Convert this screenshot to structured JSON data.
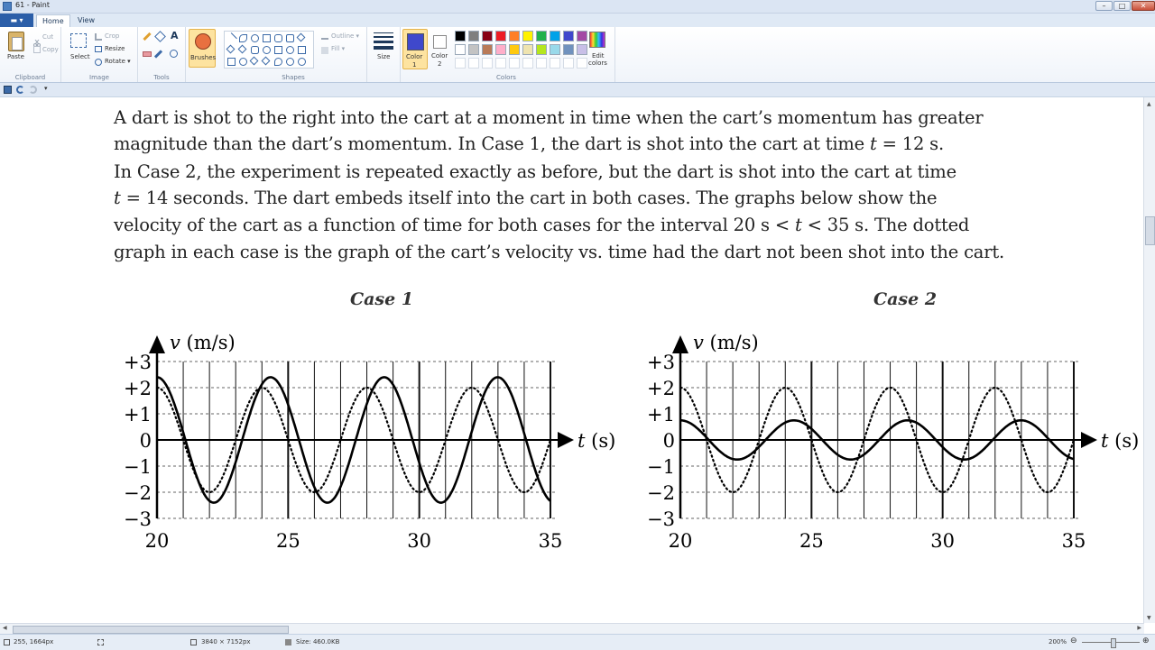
{
  "window": {
    "title": "61 - Paint",
    "minimize": "–",
    "maximize": "□",
    "close": "✕"
  },
  "tabs": {
    "file": "▬ ▾",
    "home": "Home",
    "view": "View"
  },
  "ribbon": {
    "clipboard": {
      "label": "Clipboard",
      "paste": "Paste",
      "cut": "Cut",
      "copy": "Copy"
    },
    "image": {
      "label": "Image",
      "select": "Select",
      "crop": "Crop",
      "resize": "Resize",
      "rotate": "Rotate ▾"
    },
    "tools": {
      "label": "Tools"
    },
    "brushes": {
      "label": "Brushes"
    },
    "shapes": {
      "label": "Shapes",
      "outline": "Outline ▾",
      "fill": "Fill ▾"
    },
    "size": {
      "label": "Size"
    },
    "color1": {
      "label1": "Color",
      "label2": "1",
      "value": "#3f48cc"
    },
    "color2": {
      "label1": "Color",
      "label2": "2",
      "value": "#ffffff"
    },
    "colors": {
      "label": "Colors",
      "edit1": "Edit",
      "edit2": "colors",
      "palette_row1": [
        "#000000",
        "#7f7f7f",
        "#880015",
        "#ed1c24",
        "#ff7f27",
        "#fff200",
        "#22b14c",
        "#00a2e8",
        "#3f48cc",
        "#a349a4"
      ],
      "palette_row2": [
        "#ffffff",
        "#c3c3c3",
        "#b97a57",
        "#ffaec9",
        "#ffc90e",
        "#efe4b0",
        "#b5e61d",
        "#99d9ea",
        "#7092be",
        "#c8bfe7"
      ]
    }
  },
  "document": {
    "lines": [
      "A dart is shot to the right into the cart at a moment in time when the cart’s momentum has greater",
      "magnitude than the dart’s momentum. In Case 1, the dart is shot into the cart at time 𝑡 = 12 s.",
      "In Case 2, the experiment is repeated exactly as before, but the dart is shot into the cart at time",
      "𝑡 = 14 seconds. The dart embeds itself into the cart in both cases. The graphs below show the",
      "velocity of the cart as a function of time for both cases for the interval 20 s < 𝑡 < 35 s. The dotted",
      "graph in each case is the graph of the cart’s velocity vs. time had the dart not been shot into the cart."
    ]
  },
  "chart_data": [
    {
      "type": "line",
      "title": "Case 1",
      "xlabel": "t (s)",
      "ylabel": "v (m/s)",
      "xlim": [
        20,
        35
      ],
      "ylim": [
        -3,
        3
      ],
      "xticks": [
        "20",
        "25",
        "30",
        "35"
      ],
      "yticks": [
        "+3",
        "+2",
        "+1",
        "0",
        "−1",
        "−2",
        "−3"
      ],
      "series": [
        {
          "style": "solid",
          "amplitude": 2.4,
          "period": 4.33,
          "x": [
            20,
            20.5,
            21,
            21.5,
            22,
            22.5,
            23,
            23.5,
            24,
            24.5,
            25,
            25.5,
            26,
            26.5,
            27,
            27.5,
            28,
            28.5,
            29,
            29.5,
            30,
            30.5,
            31,
            31.5,
            32,
            32.5,
            33,
            33.5,
            34,
            34.5,
            35
          ],
          "y": [
            2.4,
            1.7,
            0.2,
            -1.4,
            -2.4,
            -2.1,
            -0.8,
            1.0,
            2.2,
            2.3,
            1.1,
            -0.6,
            -2.0,
            -2.4,
            -1.6,
            0.0,
            1.6,
            2.4,
            2.0,
            0.6,
            -1.1,
            -2.2,
            -2.3,
            -1.1,
            0.6,
            2.0,
            2.4,
            1.6,
            0.0,
            -1.6,
            -2.4
          ]
        },
        {
          "style": "dotted",
          "amplitude": 2.0,
          "period": 4.0,
          "x": [
            20,
            21,
            22,
            23,
            24,
            25,
            26,
            27,
            28,
            29,
            30,
            31,
            32,
            33,
            34,
            35
          ],
          "y": [
            2,
            0,
            -2,
            0,
            2,
            0,
            -2,
            0,
            2,
            0,
            -2,
            0,
            2,
            0,
            -2,
            0
          ]
        }
      ]
    },
    {
      "type": "line",
      "title": "Case 2",
      "xlabel": "t (s)",
      "ylabel": "v (m/s)",
      "xlim": [
        20,
        35
      ],
      "ylim": [
        -3,
        3
      ],
      "xticks": [
        "20",
        "25",
        "30",
        "35"
      ],
      "yticks": [
        "+3",
        "+2",
        "+1",
        "0",
        "−1",
        "−2",
        "−3"
      ],
      "series": [
        {
          "style": "solid",
          "amplitude": 0.75,
          "period": 4.33,
          "x": [
            20,
            21,
            22,
            23,
            24,
            25,
            26,
            27,
            28,
            29,
            30,
            31,
            32,
            33,
            34,
            35
          ],
          "y": [
            0.75,
            -0.2,
            -0.73,
            -0.45,
            0.5,
            0.7,
            -0.25,
            -0.75,
            -0.1,
            0.65,
            0.55,
            -0.45,
            -0.7,
            0.1,
            0.75,
            0.2
          ]
        },
        {
          "style": "dotted",
          "amplitude": 2.0,
          "period": 4.0,
          "x": [
            20,
            21,
            22,
            23,
            24,
            25,
            26,
            27,
            28,
            29,
            30,
            31,
            32,
            33,
            34,
            35
          ],
          "y": [
            2,
            0,
            -2,
            0,
            2,
            0,
            -2,
            0,
            2,
            0,
            -2,
            0,
            2,
            0,
            -2,
            0
          ]
        }
      ]
    }
  ],
  "status": {
    "cursor": "255, 1664px",
    "dimensions": "3840 × 7152px",
    "size": "Size: 460.0KB",
    "zoom": "200%"
  }
}
